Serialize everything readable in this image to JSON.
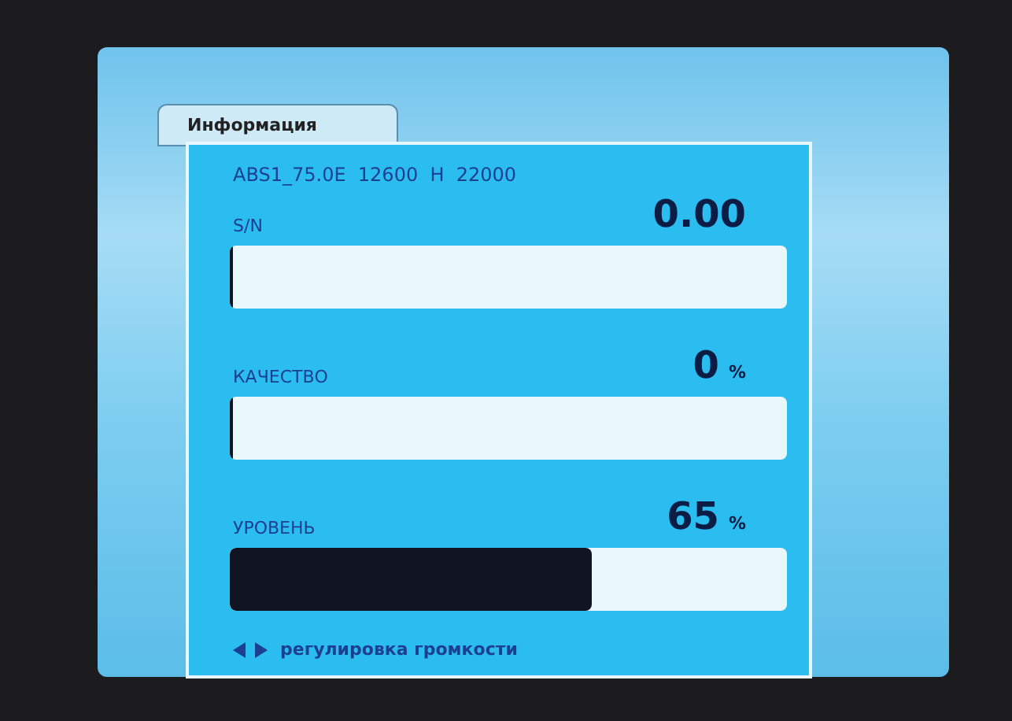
{
  "tab": {
    "label": "Информация"
  },
  "transponder": "ABS1_75.0E  12600  H  22000",
  "meters": [
    {
      "label": "S/N",
      "value": "0.00",
      "level": 0
    },
    {
      "label": "КАЧЕСТВО",
      "value": "0",
      "unit": "%",
      "level": 0
    },
    {
      "label": "УРОВЕНЬ",
      "value": "65",
      "unit": "%",
      "level": 0.65
    }
  ],
  "hint": "регулировка громкости"
}
